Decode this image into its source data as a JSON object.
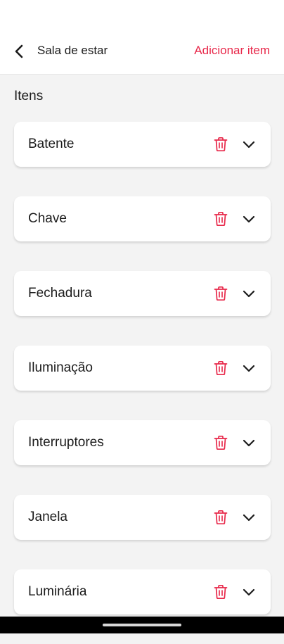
{
  "header": {
    "title": "Sala de estar",
    "add_item_label": "Adicionar item",
    "back_icon": "chevron-left-icon"
  },
  "section": {
    "title": "Itens"
  },
  "items": [
    {
      "label": "Batente"
    },
    {
      "label": "Chave"
    },
    {
      "label": "Fechadura"
    },
    {
      "label": "Iluminação"
    },
    {
      "label": "Interruptores"
    },
    {
      "label": "Janela"
    },
    {
      "label": "Luminária"
    }
  ],
  "icons": {
    "delete": "trash-icon",
    "expand": "chevron-down-icon"
  },
  "colors": {
    "accent": "#e8284a",
    "background": "#f3f3f3",
    "card": "#ffffff",
    "text": "#1b1b1b"
  }
}
